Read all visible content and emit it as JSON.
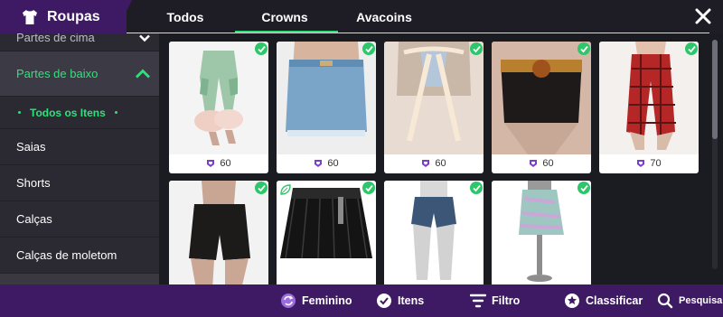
{
  "header": {
    "app_title": "Roupas",
    "tabs": [
      {
        "label": "Todos"
      },
      {
        "label": "Crowns"
      },
      {
        "label": "Avacoins"
      }
    ],
    "active_tab": "Crowns"
  },
  "sidebar": {
    "partial_item": "Partes de cima",
    "active_category": "Partes de baixo",
    "sub_item": "Todos os Itens",
    "items": [
      "Saias",
      "Shorts",
      "Calças",
      "Calças de moletom"
    ]
  },
  "items": [
    {
      "name": "cargo-pants-fur",
      "price": "60",
      "owned": true
    },
    {
      "name": "denim-mini-skirt",
      "price": "60",
      "owned": true
    },
    {
      "name": "denim-shorts-ties",
      "price": "60",
      "owned": true
    },
    {
      "name": "bear-belt-shorts",
      "price": "60",
      "owned": true
    },
    {
      "name": "plaid-pants",
      "price": "70",
      "owned": true
    },
    {
      "name": "black-shorts",
      "price": "",
      "owned": true
    },
    {
      "name": "black-pleated-skirt",
      "price": "",
      "owned": true,
      "leaf": true
    },
    {
      "name": "blue-shorts",
      "price": "",
      "owned": true
    },
    {
      "name": "pastel-skirt",
      "price": "",
      "owned": true
    }
  ],
  "bottom_bar": {
    "gender": "Feminino",
    "items": "Itens",
    "filter": "Filtro",
    "sort": "Classificar",
    "search": "Pesquisa"
  },
  "colors": {
    "accent": "#2ee27a",
    "brand_purple": "#3f1a64",
    "check_green": "#2ec66a",
    "gem_purple": "#7a3ec8"
  },
  "icons": [
    "shirt-icon",
    "close-icon",
    "chevron-up-icon",
    "chevron-down-icon",
    "check-icon",
    "gem-icon",
    "gender-icon",
    "items-check-icon",
    "filter-icon",
    "sort-star-icon",
    "search-icon",
    "leaf-icon"
  ]
}
